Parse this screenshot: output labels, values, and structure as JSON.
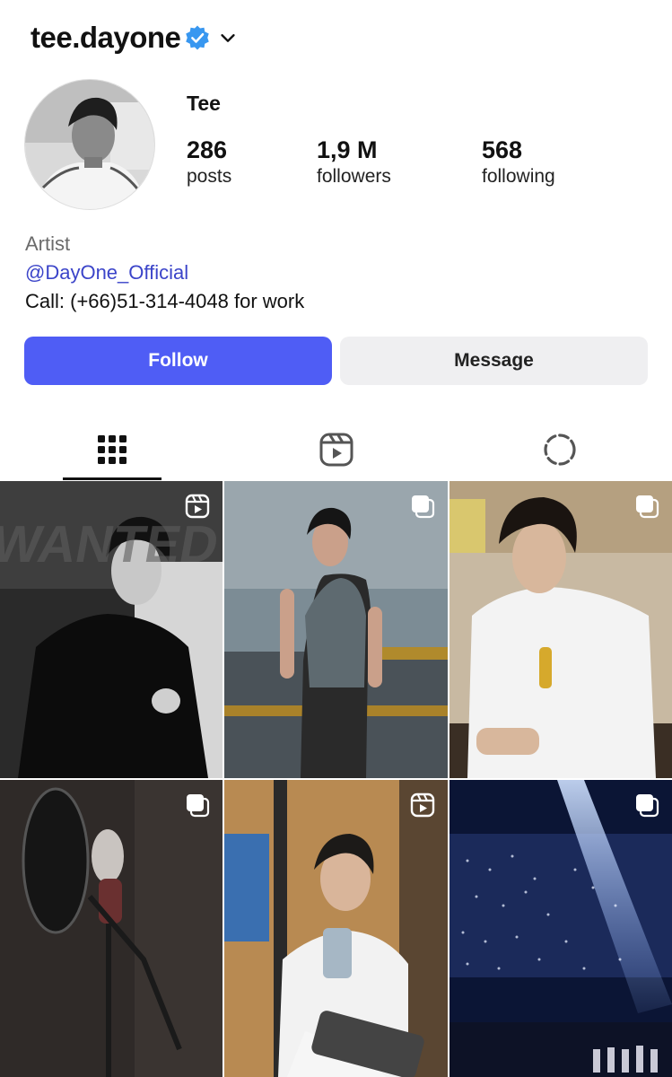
{
  "profile": {
    "username": "tee.dayone",
    "display_name": "Tee",
    "stats": {
      "posts_count": "286",
      "posts_label": "posts",
      "followers_count": "1,9 M",
      "followers_label": "followers",
      "following_count": "568",
      "following_label": "following"
    },
    "bio": {
      "category": "Artist",
      "link": "@DayOne_Official",
      "text": "Call: (+66)51-314-4048 for work"
    }
  },
  "actions": {
    "follow_label": "Follow",
    "message_label": "Message"
  },
  "tabs": [
    {
      "icon": "grid-icon",
      "active": true
    },
    {
      "icon": "reels-icon",
      "active": false
    },
    {
      "icon": "tagged-icon",
      "active": false
    }
  ],
  "colors": {
    "follow_button": "#4f5df5",
    "message_button": "#efeff1",
    "link": "#3b44c9",
    "verified_badge": "#3897f0"
  },
  "posts": [
    {
      "type": "reel",
      "badge_icon": "reels-icon",
      "overlay_text": "WANTED"
    },
    {
      "type": "carousel",
      "badge_icon": "carousel-icon"
    },
    {
      "type": "carousel",
      "badge_icon": "carousel-icon"
    },
    {
      "type": "carousel",
      "badge_icon": "carousel-icon"
    },
    {
      "type": "reel",
      "badge_icon": "reels-icon"
    },
    {
      "type": "carousel",
      "badge_icon": "carousel-icon"
    }
  ]
}
